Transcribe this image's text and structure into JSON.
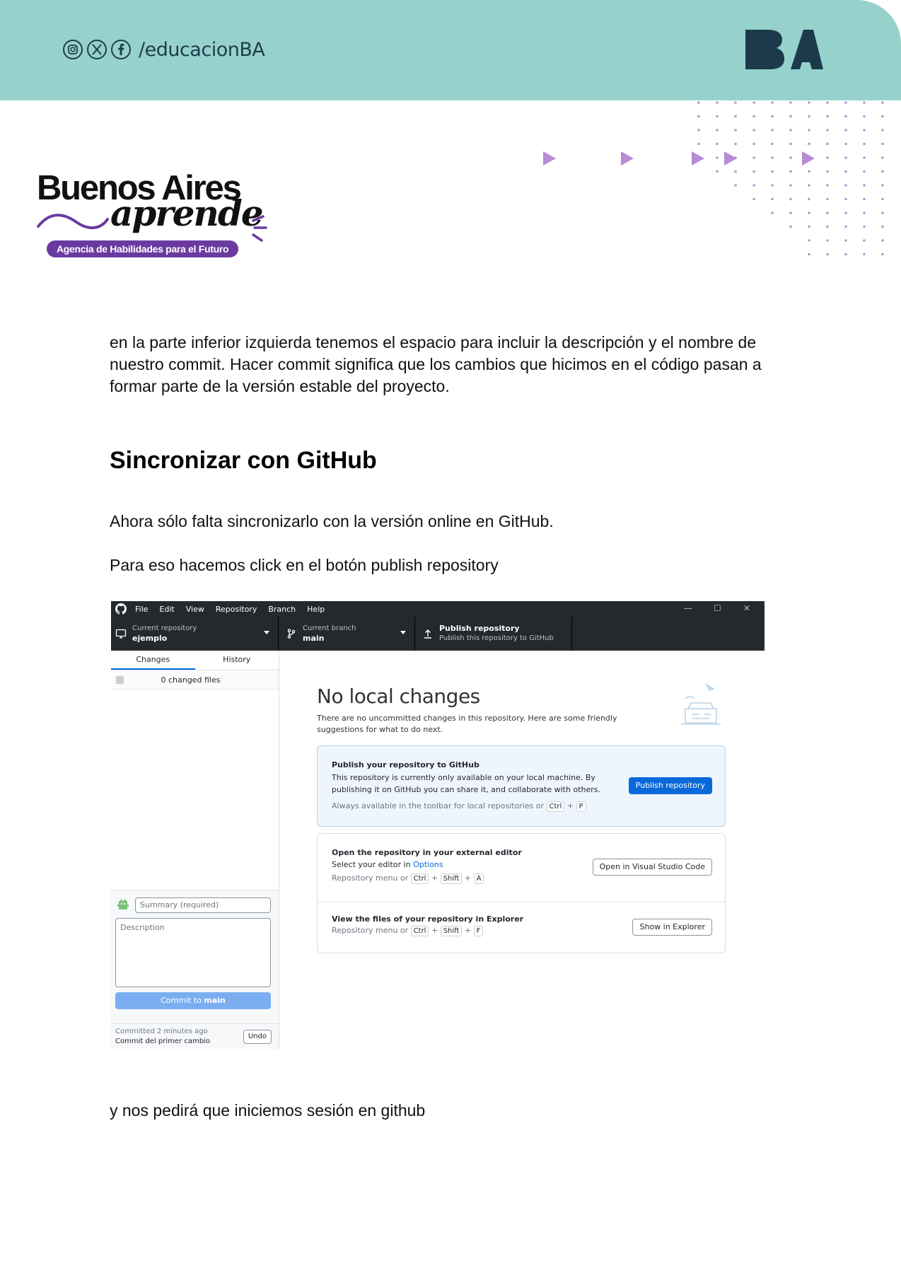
{
  "header": {
    "social_icons": [
      "instagram-icon",
      "x-icon",
      "facebook-icon"
    ],
    "handle": "/educacionBA",
    "logo": "BA",
    "band_color": "#96d2cb"
  },
  "brand": {
    "title": "Buenos Aires",
    "script": "aprende",
    "tagline": "Agencia de Habilidades para el Futuro",
    "accent_color": "#6b3aa1"
  },
  "document": {
    "paragraph_intro": "en la parte inferior izquierda tenemos el espacio para incluir la descripción y el nombre de nuestro commit. Hacer commit significa que los cambios que hicimos en el código pasan a formar parte de la versión estable del proyecto.",
    "heading_sync": "Sincronizar con GitHub",
    "paragraph_ahora": "Ahora sólo falta sincronizarlo con la versión online en GitHub.",
    "paragraph_para": "Para eso hacemos click en el botón publish repository",
    "paragraph_final": "y nos pedirá que iniciemos sesión en github"
  },
  "app": {
    "menu": [
      "File",
      "Edit",
      "View",
      "Repository",
      "Branch",
      "Help"
    ],
    "window_controls": {
      "minimize": "—",
      "maximize": "☐",
      "close": "✕"
    },
    "toolbar": {
      "repo_label": "Current repository",
      "repo_value": "ejemplo",
      "branch_label": "Current branch",
      "branch_value": "main",
      "publish_label": "Publish repository",
      "publish_sub": "Publish this repository to GitHub"
    },
    "sidebar": {
      "tabs": [
        "Changes",
        "History"
      ],
      "changed_files": "0 changed files",
      "summary_placeholder": "Summary (required)",
      "description_placeholder": "Description",
      "commit_prefix": "Commit to ",
      "commit_branch": "main",
      "committed_when": "Committed 2 minutes ago",
      "committed_msg": "Commit del primer cambio",
      "undo": "Undo"
    },
    "main": {
      "title": "No local changes",
      "text": "There are no uncommitted changes in this repository. Here are some friendly suggestions for what to do next.",
      "publish_card": {
        "title": "Publish your repository to GitHub",
        "text": "This repository is currently only available on your local machine. By publishing it on GitHub you can share it, and collaborate with others.",
        "hint_prefix": "Always available in the toolbar for local repositories or",
        "key1": "Ctrl",
        "plus": "+",
        "key2": "P",
        "button": "Publish repository"
      },
      "editor_card": {
        "title": "Open the repository in your external editor",
        "text_prefix": "Select your editor in",
        "text_link": "Options",
        "hint_prefix": "Repository menu or",
        "key1": "Ctrl",
        "key2": "Shift",
        "key3": "A",
        "button": "Open in Visual Studio Code"
      },
      "explorer_card": {
        "title": "View the files of your repository in Explorer",
        "hint_prefix": "Repository menu or",
        "key1": "Ctrl",
        "key2": "Shift",
        "key3": "F",
        "button": "Show in Explorer"
      }
    }
  }
}
